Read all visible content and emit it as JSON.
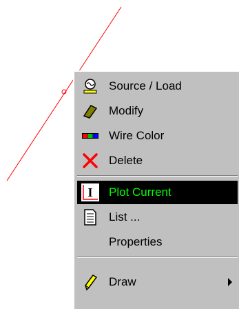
{
  "menu": {
    "items": [
      {
        "label": "Source / Load",
        "icon": "source-load-icon"
      },
      {
        "label": "Modify",
        "icon": "eraser-icon"
      },
      {
        "label": "Wire Color",
        "icon": "wire-color-icon"
      },
      {
        "label": "Delete",
        "icon": "delete-x-icon"
      },
      {
        "label": "Plot Current",
        "icon": "plot-current-icon",
        "selected": true
      },
      {
        "label": "List ...",
        "icon": "list-document-icon"
      },
      {
        "label": "Properties",
        "icon": ""
      },
      {
        "label": "Draw",
        "icon": "pencil-icon",
        "submenu": true
      }
    ]
  },
  "colors": {
    "wire": "#ff0000",
    "menu_bg": "#c0c0c0",
    "highlight_bg": "#000000",
    "highlight_text": "#00ff00"
  }
}
